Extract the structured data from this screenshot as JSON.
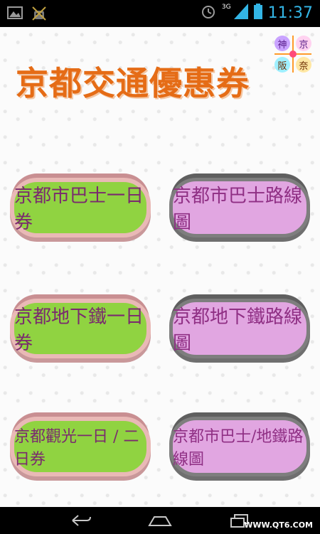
{
  "status_bar": {
    "clock": "11:37",
    "network": "3G",
    "icons": [
      "image-icon",
      "android-debug-icon",
      "alarm-icon",
      "signal-icon",
      "battery-icon"
    ]
  },
  "app": {
    "title": "京都交通優惠券",
    "logo": {
      "tl": "神",
      "tr": "京",
      "bl": "阪",
      "br": "奈"
    },
    "buttons": {
      "bus_day_pass": "京都市巴士一日券",
      "bus_route_map": "京都市巴士路線圖",
      "subway_day_pass": "京都地下鐵一日券",
      "subway_route_map": "京都地下鐵路線圖",
      "sightseeing_pass": "京都觀光一日 / 二日券",
      "bus_subway_map": "京都市巴士/地鐵路線圖"
    }
  },
  "nav_bar": {
    "watermark": "WWW.QT6.COM",
    "icons": [
      "back-icon",
      "home-icon",
      "recents-icon"
    ]
  },
  "colors": {
    "title": "#e56c16",
    "green_button": "#90d341",
    "purple_button": "#e1a6e1",
    "status_accent": "#33b5e5"
  }
}
